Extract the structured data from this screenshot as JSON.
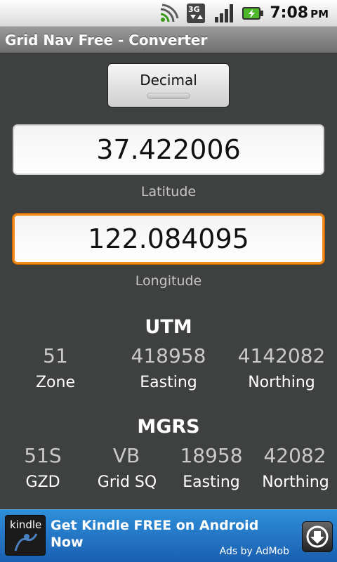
{
  "status_bar": {
    "time": "7:08",
    "ampm": "PM",
    "icons": [
      "sync-icon",
      "3g-data-icon",
      "signal-strength-icon",
      "battery-charging-icon"
    ],
    "colors": {
      "sync": "#3a9a1a",
      "battery": "#4fb82a"
    }
  },
  "title_bar": {
    "title": "Grid Nav Free - Converter"
  },
  "mode_button": {
    "label": "Decimal"
  },
  "latitude": {
    "value": "37.422006",
    "label": "Latitude"
  },
  "longitude": {
    "value": "122.084095",
    "label": "Longitude"
  },
  "utm": {
    "title": "UTM",
    "values": [
      "51",
      "418958",
      "4142082"
    ],
    "labels": [
      "Zone",
      "Easting",
      "Northing"
    ]
  },
  "mgrs": {
    "title": "MGRS",
    "values": [
      "51S",
      "VB",
      "18958",
      "42082"
    ],
    "labels": [
      "GZD",
      "Grid SQ",
      "Easting",
      "Northing"
    ]
  },
  "ad": {
    "logo_text": "kindle",
    "headline": "Get Kindle FREE on Android Now",
    "attribution": "Ads by AdMob",
    "download_icon": "download-icon"
  },
  "colors": {
    "background": "#3f4040",
    "focus_accent": "#f08b1c",
    "ad_banner": "#2f8fd9"
  }
}
